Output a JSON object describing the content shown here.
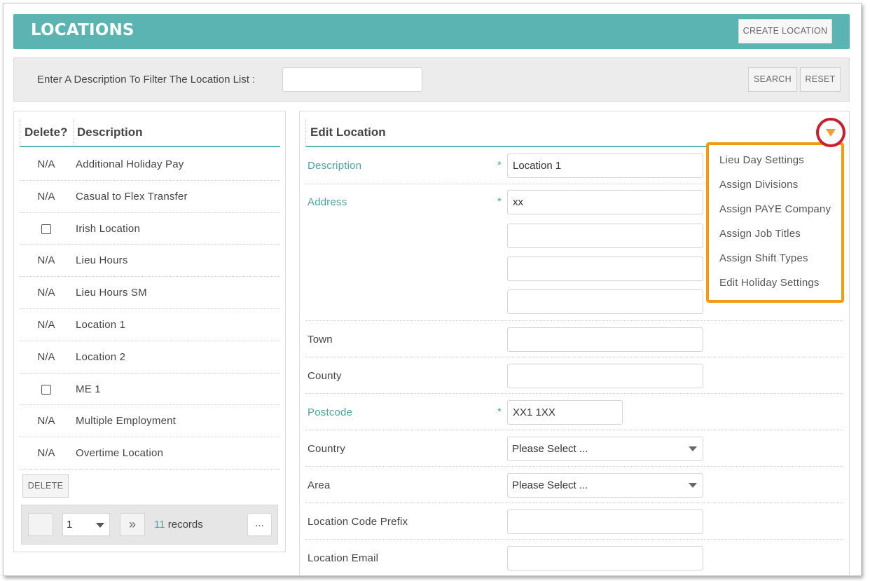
{
  "header": {
    "title": "LOCATIONS",
    "create_label": "CREATE LOCATION"
  },
  "filter": {
    "label": "Enter A Description To Filter The Location List :",
    "value": "",
    "search_label": "SEARCH",
    "reset_label": "RESET"
  },
  "list": {
    "col_delete": "Delete?",
    "col_description": "Description",
    "rows": [
      {
        "delete": "N/A",
        "description": "Additional Holiday Pay"
      },
      {
        "delete": "N/A",
        "description": "Casual to Flex Transfer"
      },
      {
        "delete": "checkbox",
        "description": "Irish Location"
      },
      {
        "delete": "N/A",
        "description": "Lieu Hours"
      },
      {
        "delete": "N/A",
        "description": "Lieu Hours SM"
      },
      {
        "delete": "N/A",
        "description": "Location 1"
      },
      {
        "delete": "N/A",
        "description": "Location 2"
      },
      {
        "delete": "checkbox",
        "description": "ME 1"
      },
      {
        "delete": "N/A",
        "description": "Multiple Employment"
      },
      {
        "delete": "N/A",
        "description": "Overtime Location"
      }
    ],
    "delete_label": "DELETE",
    "pager": {
      "page": "1",
      "next_label": "»",
      "records_count": "11",
      "records_label": "records",
      "more_label": "..."
    }
  },
  "edit": {
    "title": "Edit Location",
    "required_mark": "*",
    "fields": {
      "description": {
        "label": "Description",
        "value": "Location 1"
      },
      "address": {
        "label": "Address",
        "line1": "xx",
        "line2": "",
        "line3": "",
        "line4": ""
      },
      "town": {
        "label": "Town",
        "value": ""
      },
      "county": {
        "label": "County",
        "value": ""
      },
      "postcode": {
        "label": "Postcode",
        "value": "XX1 1XX"
      },
      "country": {
        "label": "Country",
        "value": "Please Select ..."
      },
      "area": {
        "label": "Area",
        "value": "Please Select ..."
      },
      "code_prefix": {
        "label": "Location Code Prefix",
        "value": ""
      },
      "email": {
        "label": "Location Email",
        "value": ""
      }
    }
  },
  "menu": {
    "items": [
      "Lieu Day Settings",
      "Assign Divisions",
      "Assign PAYE Company",
      "Assign Job Titles",
      "Assign Shift Types",
      "Edit Holiday Settings"
    ],
    "highlight_color": "#f39a12",
    "toggle_ring_color": "#c8202e"
  },
  "colors": {
    "accent": "#5cb4b2",
    "required_label": "#4aa3a1"
  }
}
